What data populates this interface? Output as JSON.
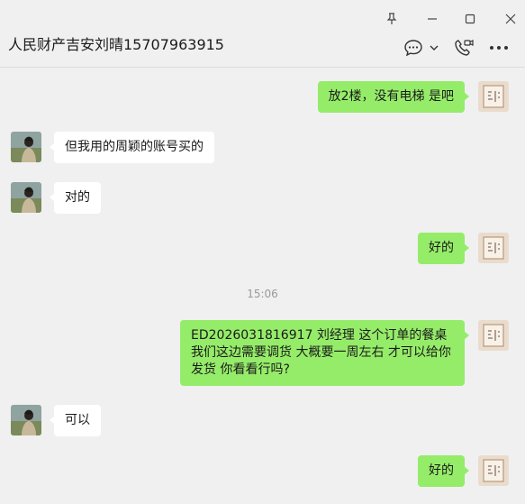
{
  "window": {
    "title": "人民财产吉安刘晴15707963915"
  },
  "icons": {
    "pin": "pin-icon",
    "minimize": "minimize-icon",
    "maximize": "maximize-icon",
    "close": "close-icon",
    "chat": "chat-bubble-icon",
    "chevron": "chevron-down-icon",
    "video_call": "video-call-icon",
    "more": "more-icon"
  },
  "colors": {
    "my_bubble": "#95ec69",
    "their_bubble": "#ffffff",
    "background": "#f0f0f0"
  },
  "messages": [
    {
      "sender": "me",
      "text": "放2楼，没有电梯   是吧"
    },
    {
      "sender": "them",
      "text": "但我用的周颖的账号买的"
    },
    {
      "sender": "them",
      "text": "对的"
    },
    {
      "sender": "me",
      "text": "好的"
    },
    {
      "sender": "me",
      "lines": [
        "ED2026031816917    刘经理 这个订单的餐桌",
        "我们这边需要调货  大概要一周左右 才可以给你",
        "发货  你看看行吗?"
      ]
    },
    {
      "sender": "them",
      "text": "可以"
    },
    {
      "sender": "me",
      "text": "好的"
    }
  ],
  "timestamp": "15:06"
}
